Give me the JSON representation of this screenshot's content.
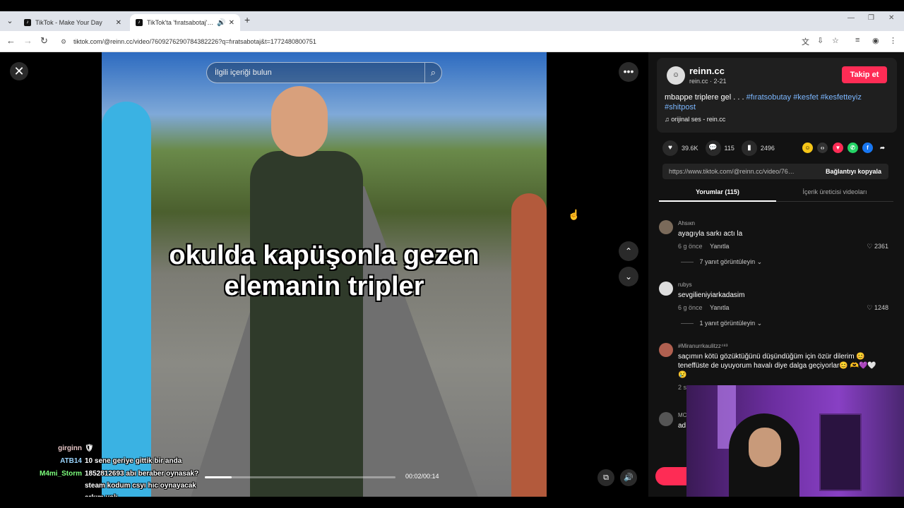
{
  "browser": {
    "tabs": [
      {
        "title": "TikTok - Make Your Day",
        "active": false
      },
      {
        "title": "TikTok'ta 'fıratsabotaj' bulu",
        "active": true
      }
    ],
    "url": "tiktok.com/@reinn.cc/video/7609276290784382226?q=fıratsabotaj&t=1772480800751"
  },
  "video": {
    "search_placeholder": "İlgili içeriği bulun",
    "caption_line1": "okulda kapüşonla gezen",
    "caption_line2": "elemanin tripler",
    "time": "00:02/00:14",
    "progress": 0.14
  },
  "author": {
    "name": "reinn.cc",
    "sub": "rein.cc · 2-21",
    "follow_label": "Takip et",
    "description": "mbappe triplere gel . . .",
    "hashtags": [
      "#fıratsobutay",
      "#kesfet",
      "#kesfetteyiz",
      "#shitpost"
    ],
    "music": "orijinal ses - rein.cc"
  },
  "stats": {
    "likes": "39.6K",
    "comments": "115",
    "saves": "2496"
  },
  "link": {
    "url": "https://www.tiktok.com/@reinn.cc/video/760...",
    "copy_label": "Bağlantıyı kopyala"
  },
  "tabs": {
    "comments": "Yorumlar (115)",
    "creator_videos": "İçerik üreticisi videoları"
  },
  "comments": [
    {
      "user": "Ahsıкn",
      "text": "ayagıyla sarkı actı la",
      "time": "6 g önce",
      "reply": "Yanıtla",
      "likes": "2361",
      "replies": "7 yanıt görüntüleyin"
    },
    {
      "user": "rubys",
      "text": "sevgilieniyiarkadasim",
      "time": "6 g önce",
      "reply": "Yanıtla",
      "likes": "1248",
      "replies": "1 yanıt görüntüleyin"
    },
    {
      "user": "#Miranurrkaulitzz⁴⁸³",
      "text": "saçımın kötü gözüktüğünü düşündüğüm için özür dilerim 😊 teneffüste de uyuyorum havalı diye dalga geçiyorlar😊 🫶💜🤍😢",
      "time": "2 s"
    },
    {
      "user": "MC",
      "text": "ad"
    }
  ],
  "chat": [
    {
      "name": "girginn",
      "name_color": "#e7c6c6",
      "text": ""
    },
    {
      "name": "ATB14",
      "name_color": "#9bd6ff",
      "text": "10 sene geriye gittik bir anda"
    },
    {
      "name": "M4mi_Storm",
      "name_color": "#7cff7c",
      "text": "1852812693 abı beraber oynasak?"
    },
    {
      "name": "",
      "name_color": "#ffffff",
      "text": "steam kodum csyı hıc oynayacak"
    },
    {
      "name": "",
      "name_color": "#ffffff",
      "text": "arkım yok"
    }
  ],
  "colors": {
    "accent": "#fe2c55",
    "hashtag": "#7cb7ff",
    "panel_bg": "#121212"
  }
}
